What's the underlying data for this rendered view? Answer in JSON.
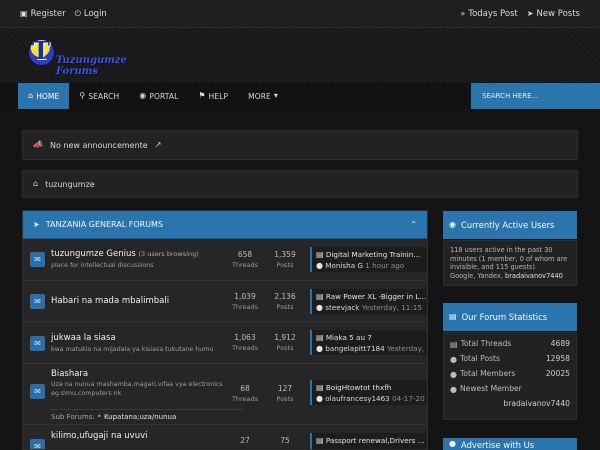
{
  "topbar": {
    "register": "Register",
    "login": "Login",
    "todays_post": "Todays Post",
    "new_posts": "New Posts"
  },
  "logo": {
    "letter": "T",
    "text": "Tuzungumze Forums"
  },
  "nav": {
    "home": "HOME",
    "search": "SEARCH",
    "portal": "PORTAL",
    "help": "HELP",
    "more": "MORE",
    "search_placeholder": "SEARCH HERE..."
  },
  "announcement": "No new announcemente",
  "breadcrumb": "tuzungumze",
  "category": {
    "title": "TANZANIA GENERAL FORUMS",
    "forums": [
      {
        "title": "tuzungumze Genius",
        "browsing": "(3 users browsing)",
        "desc": "place for intellectual discussions",
        "threads": "658",
        "posts": "1,359",
        "last_title": "Digital Marketing Trainin...",
        "last_user": "Monisha G",
        "last_date": "1 hour ago"
      },
      {
        "title": "Habari na mada mbalimbali",
        "browsing": "",
        "desc": "",
        "threads": "1,039",
        "posts": "2,136",
        "last_title": "Raw Power XL -Bigger in L...",
        "last_user": "steevjack",
        "last_date": "Yesterday, 11:15"
      },
      {
        "title": "jukwaa la siasa",
        "browsing": "",
        "desc": "kwa matukio na mijadala ya kisiasa tukutane humu",
        "threads": "1,063",
        "posts": "1,912",
        "last_title": "Miaka 5 au 7",
        "last_user": "bangelapitt7184",
        "last_date": "Yesterday,"
      },
      {
        "title": "Biashara",
        "browsing": "",
        "desc": "Uza na nunua mashamba,magari,vifaa vya electronics eg.simu,computers nk",
        "threads": "68",
        "posts": "127",
        "last_title": "BoigHtowtot thxfh",
        "last_user": "olaufrancesy1463",
        "last_date": "04-17-20",
        "subforums_label": "Sub Forums:",
        "subforum": "Kupatana;uza/nunua"
      },
      {
        "title": "kilimo,ufugaji na uvuvi",
        "browsing": "",
        "desc": "",
        "threads": "27",
        "posts": "75",
        "last_title": "Passport renewal,Drivers ...",
        "last_user": "",
        "last_date": ""
      }
    ],
    "threads_label": "Threads",
    "posts_label": "Posts"
  },
  "active_users": {
    "title": "Currently Active Users",
    "summary": "118 users active in the past 30 minutes (1 member, 0 of whom are invisible, and 115 guests).",
    "names_prefix": "Google, Yandex, ",
    "member": "bradaivanov7440"
  },
  "statistics": {
    "title": "Our Forum Statistics",
    "threads_label": "Total Threads",
    "threads": "4689",
    "posts_label": "Total Posts",
    "posts": "12958",
    "members_label": "Total Members",
    "members": "20025",
    "newest_label": "Newest Member",
    "newest": "bradaivanov7440"
  },
  "advertise": {
    "title": "Advertise with Us"
  },
  "colors": {
    "accent": "#2a75ae",
    "background": "#161616",
    "panel": "#222222"
  }
}
